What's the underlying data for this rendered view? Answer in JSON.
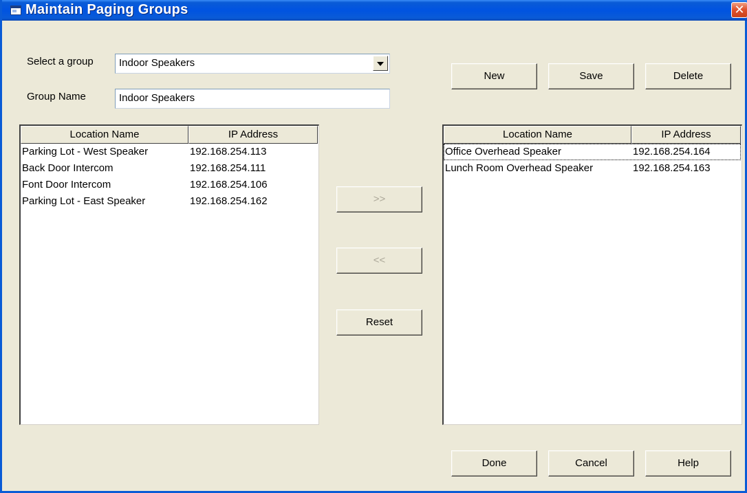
{
  "window": {
    "title": "Maintain Paging Groups",
    "close_glyph": "✕"
  },
  "form": {
    "select_group_label": "Select a group",
    "select_group_value": "Indoor Speakers",
    "group_name_label": "Group Name",
    "group_name_value": "Indoor Speakers"
  },
  "toolbar": {
    "new_label": "New",
    "save_label": "Save",
    "delete_label": "Delete"
  },
  "transfer": {
    "add_label": ">>",
    "remove_label": "<<",
    "reset_label": "Reset"
  },
  "available": {
    "columns": [
      "Location Name",
      "IP Address"
    ],
    "rows": [
      {
        "name": "Parking Lot - West Speaker",
        "ip": "192.168.254.113"
      },
      {
        "name": "Back Door Intercom",
        "ip": "192.168.254.111"
      },
      {
        "name": "Font Door Intercom",
        "ip": "192.168.254.106"
      },
      {
        "name": "Parking Lot - East Speaker",
        "ip": "192.168.254.162"
      }
    ]
  },
  "members": {
    "columns": [
      "Location Name",
      "IP Address"
    ],
    "rows": [
      {
        "name": "Office Overhead Speaker",
        "ip": "192.168.254.164"
      },
      {
        "name": "Lunch Room Overhead Speaker",
        "ip": "192.168.254.163"
      }
    ]
  },
  "footer": {
    "done_label": "Done",
    "cancel_label": "Cancel",
    "help_label": "Help"
  },
  "colors": {
    "titlebar": "#0a5bd6",
    "dialog_bg": "#ece9d8",
    "disabled_text": "#aca899",
    "close_button": "#e1532e"
  },
  "icons": [
    "window-app-icon",
    "close-icon",
    "dropdown-arrow-icon"
  ]
}
